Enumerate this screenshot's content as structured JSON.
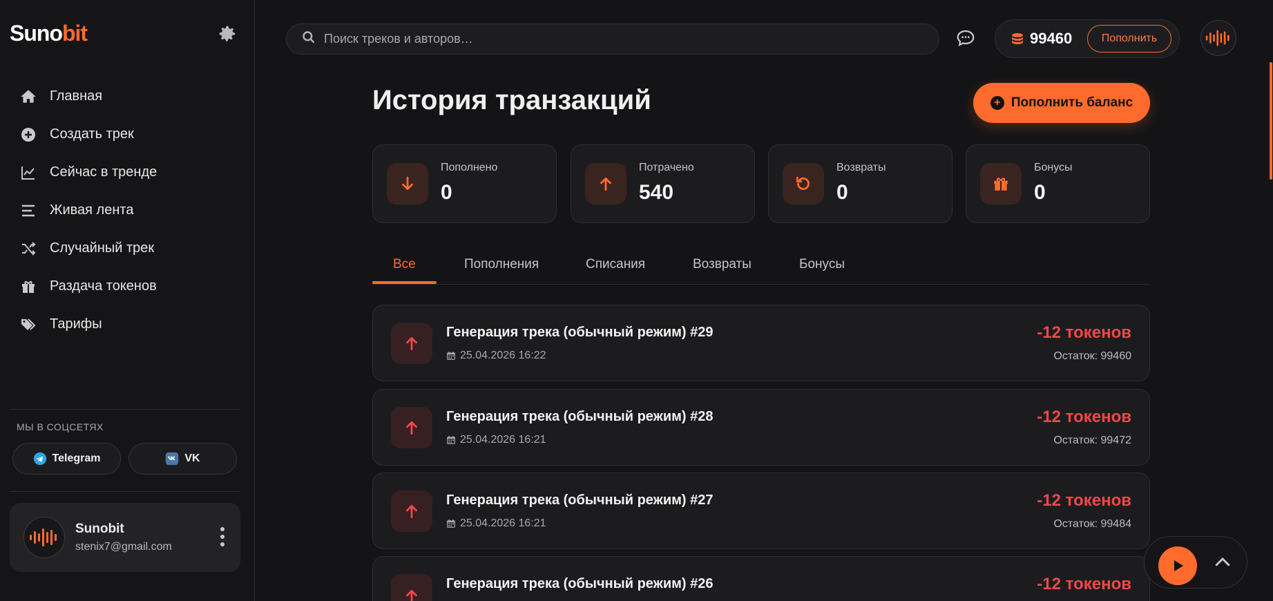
{
  "brand": {
    "logo_white": "Suno",
    "logo_orange": "bit",
    "accent": "#ff6b2c"
  },
  "sidebar": {
    "items": [
      {
        "label": "Главная",
        "icon": "home-icon"
      },
      {
        "label": "Создать трек",
        "icon": "plus-circle-icon"
      },
      {
        "label": "Сейчас в тренде",
        "icon": "chart-line-icon"
      },
      {
        "label": "Живая лента",
        "icon": "list-icon"
      },
      {
        "label": "Случайный трек",
        "icon": "shuffle-icon"
      },
      {
        "label": "Раздача токенов",
        "icon": "gift-icon"
      },
      {
        "label": "Тарифы",
        "icon": "tags-icon"
      }
    ],
    "social_title": "МЫ В СОЦСЕТЯХ",
    "telegram": "Telegram",
    "vk": "VK",
    "user": {
      "name": "Sunobit",
      "email": "stenix7@gmail.com"
    }
  },
  "topbar": {
    "search_placeholder": "Поиск треков и авторов…",
    "balance": "99460",
    "topup_label": "Пополнить"
  },
  "main": {
    "title": "История транзакций",
    "topup_button": "Пополнить баланс",
    "stats": [
      {
        "label": "Пополнено",
        "value": "0",
        "icon": "arrow-down-icon"
      },
      {
        "label": "Потрачено",
        "value": "540",
        "icon": "arrow-up-icon"
      },
      {
        "label": "Возвраты",
        "value": "0",
        "icon": "undo-icon"
      },
      {
        "label": "Бонусы",
        "value": "0",
        "icon": "gift-icon"
      }
    ],
    "tabs": [
      "Все",
      "Пополнения",
      "Списания",
      "Возвраты",
      "Бонусы"
    ],
    "active_tab": "Все",
    "transactions": [
      {
        "title": "Генерация трека (обычный режим) #29",
        "date": "25.04.2026 16:22",
        "amount": "-12 токенов",
        "rest": "Остаток: 99460"
      },
      {
        "title": "Генерация трека (обычный режим) #28",
        "date": "25.04.2026 16:21",
        "amount": "-12 токенов",
        "rest": "Остаток: 99472"
      },
      {
        "title": "Генерация трека (обычный режим) #27",
        "date": "25.04.2026 16:21",
        "amount": "-12 токенов",
        "rest": "Остаток: 99484"
      },
      {
        "title": "Генерация трека (обычный режим) #26",
        "date": "",
        "amount": "-12 токенов",
        "rest": ""
      }
    ]
  },
  "colors": {
    "negative": "#f04848",
    "accent": "#ff6b2c",
    "bg": "#141416"
  }
}
